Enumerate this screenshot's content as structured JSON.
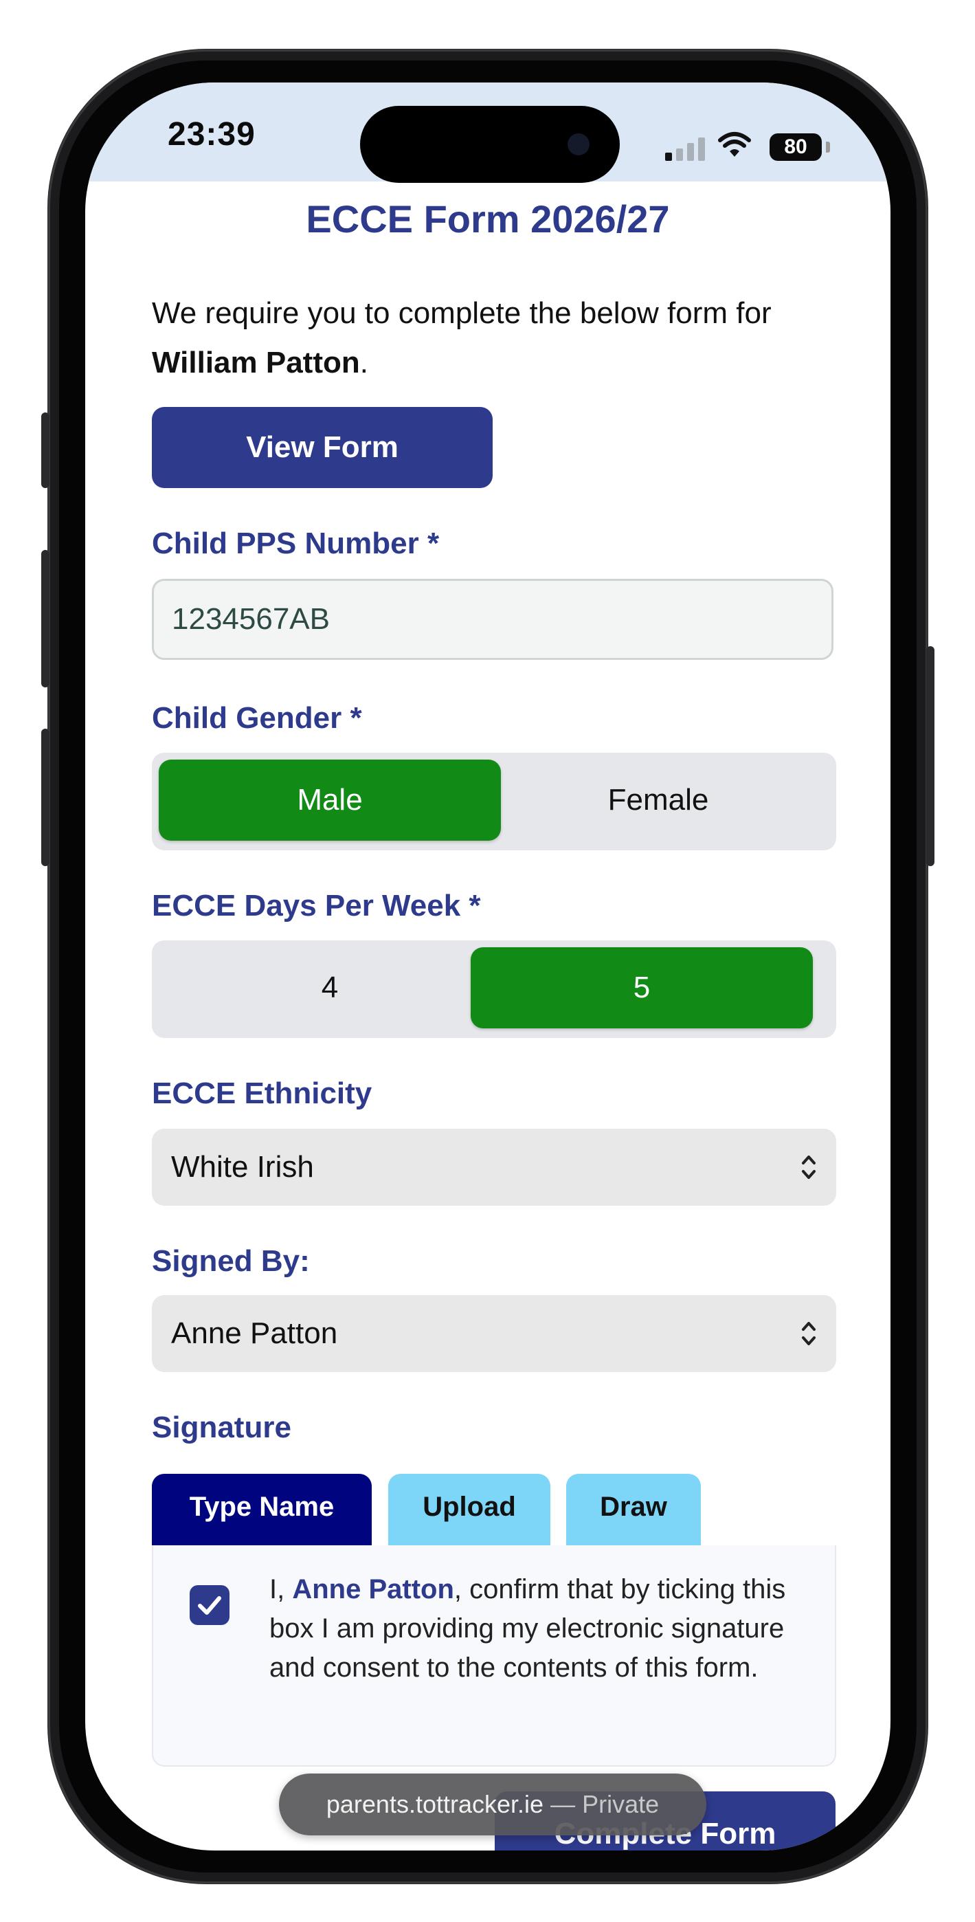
{
  "status_bar": {
    "time": "23:39",
    "battery": "80"
  },
  "page": {
    "title": "ECCE Form 2026/27",
    "intro_prefix": "We require you to complete the below form for ",
    "child_name": "William Patton",
    "intro_suffix": ".",
    "view_form_label": "View Form"
  },
  "fields": {
    "pps": {
      "label": "Child PPS Number *",
      "value": "1234567AB"
    },
    "gender": {
      "label": "Child Gender *",
      "options": [
        "Male",
        "Female"
      ],
      "selected": "Male"
    },
    "days": {
      "label": "ECCE Days Per Week *",
      "options": [
        "4",
        "5"
      ],
      "selected": "5"
    },
    "ethnicity": {
      "label": "ECCE Ethnicity",
      "value": "White Irish"
    },
    "signed_by": {
      "label": "Signed By:",
      "value": "Anne Patton"
    }
  },
  "signature": {
    "label": "Signature",
    "tabs": [
      "Type Name",
      "Upload",
      "Draw"
    ],
    "active_tab": "Type Name",
    "consent_prefix": "I, ",
    "consent_name": "Anne Patton",
    "consent_suffix": ", confirm that by ticking this box I am providing my electronic signature and consent to the contents of this form.",
    "checked": true
  },
  "complete_label": "Complete Form",
  "browser": {
    "domain": "parents.tottracker.ie",
    "private_label": "— Private"
  },
  "colors": {
    "primary": "#2e3a8c",
    "selected": "#128a16",
    "tab_active": "#00057f",
    "tab_inactive": "#7dd6f8"
  }
}
